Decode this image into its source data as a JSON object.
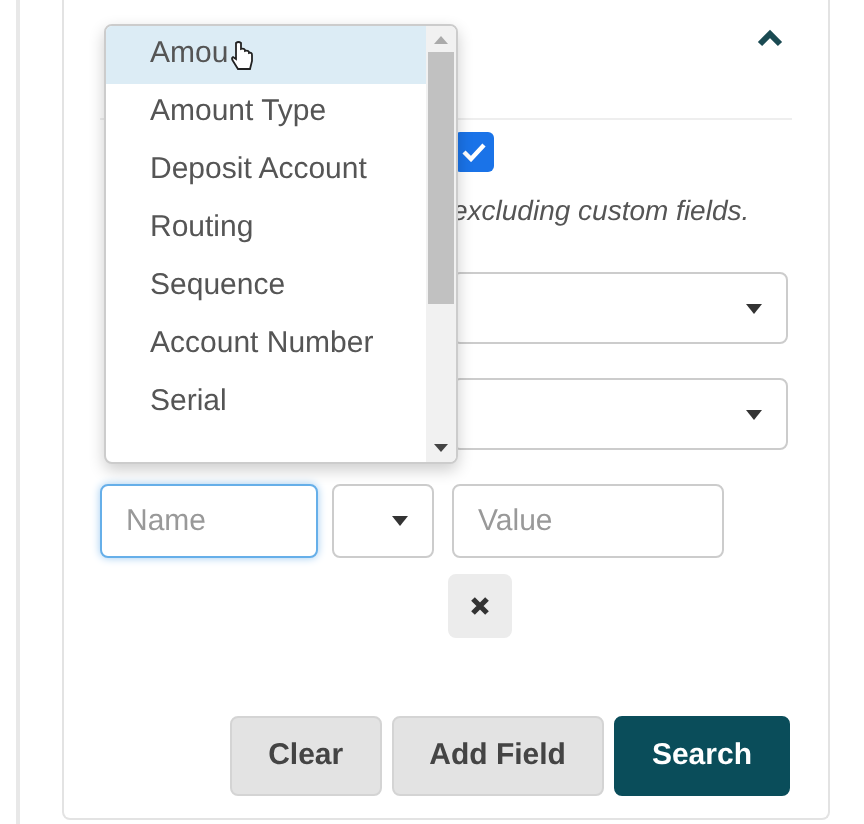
{
  "panel": {
    "expanded": true
  },
  "option": {
    "checked": true,
    "note": "excluding custom fields."
  },
  "filter": {
    "name": {
      "placeholder": "Name",
      "focused": true
    },
    "value": {
      "placeholder": "Value"
    }
  },
  "dropdown": {
    "items": [
      {
        "label": "Amou",
        "selected": true
      },
      {
        "label": "Amount Type",
        "selected": false
      },
      {
        "label": "Deposit Account",
        "selected": false
      },
      {
        "label": "Routing",
        "selected": false
      },
      {
        "label": "Sequence",
        "selected": false
      },
      {
        "label": "Account Number",
        "selected": false
      },
      {
        "label": "Serial",
        "selected": false
      }
    ]
  },
  "buttons": [
    {
      "label": "Clear",
      "kind": "secondary"
    },
    {
      "label": "Add Field",
      "kind": "secondary"
    },
    {
      "label": "Search",
      "kind": "primary"
    }
  ]
}
